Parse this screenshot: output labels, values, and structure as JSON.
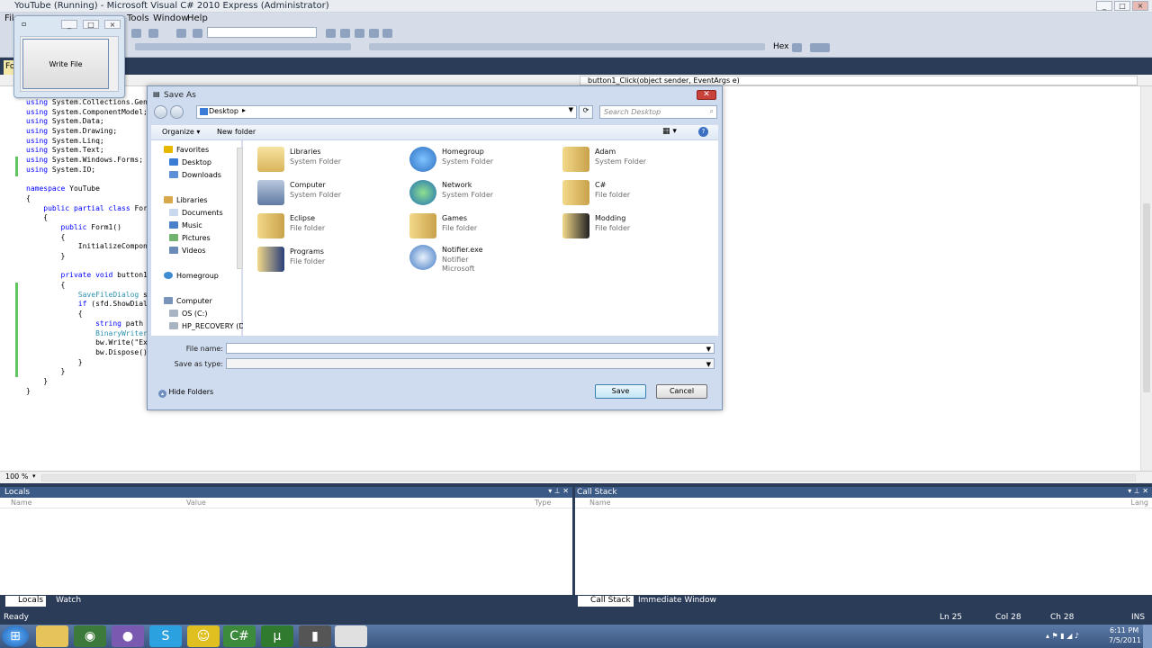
{
  "window": {
    "title": "YouTube (Running) - Microsoft Visual C# 2010 Express (Administrator)"
  },
  "menu": {
    "items": [
      "File",
      "Tools",
      "Window",
      "Help"
    ]
  },
  "doc_tab": "Fo",
  "nav_bar": {
    "method": "button1_Click(object sender, EventArgs e)"
  },
  "code_lines": [
    "using System.Collections.Gene",
    "using System.ComponentModel;",
    "using System.Data;",
    "using System.Drawing;",
    "using System.Linq;",
    "using System.Text;",
    "using System.Windows.Forms;",
    "using System.IO;",
    "",
    "namespace YouTube",
    "{",
    "    public partial class Form",
    "    {",
    "        public Form1()",
    "        {",
    "            InitializeCompone",
    "        }",
    "",
    "        private void button1_",
    "        {",
    "            SaveFileDialog s",
    "            if (sfd.ShowDial",
    "            {",
    "                string path =",
    "                BinaryWriter",
    "                bw.Write(\"Exa",
    "                bw.Dispose();",
    "            }",
    "        }",
    "    }",
    "}"
  ],
  "zoom": "100 %",
  "form1": {
    "button_label": "Write File"
  },
  "dialog": {
    "title": "Save As",
    "address": "Desktop",
    "search_placeholder": "Search Desktop",
    "organize": "Organize",
    "new_folder": "New folder",
    "nav": {
      "favorites": "Favorites",
      "desktop": "Desktop",
      "downloads": "Downloads",
      "libraries": "Libraries",
      "documents": "Documents",
      "music": "Music",
      "pictures": "Pictures",
      "videos": "Videos",
      "homegroup": "Homegroup",
      "computer": "Computer",
      "os_c": "OS (C:)",
      "hp_recovery": "HP_RECOVERY (D"
    },
    "items": [
      {
        "name": "Libraries",
        "type": "System Folder"
      },
      {
        "name": "Homegroup",
        "type": "System Folder"
      },
      {
        "name": "Adam",
        "type": "System Folder"
      },
      {
        "name": "Computer",
        "type": "System Folder"
      },
      {
        "name": "Network",
        "type": "System Folder"
      },
      {
        "name": "C#",
        "type": "File folder"
      },
      {
        "name": "Eclipse",
        "type": "File folder"
      },
      {
        "name": "Games",
        "type": "File folder"
      },
      {
        "name": "Modding",
        "type": "File folder"
      },
      {
        "name": "Programs",
        "type": "File folder"
      },
      {
        "name": "Notifier.exe",
        "type": "Notifier",
        "extra": "Microsoft"
      }
    ],
    "file_name_label": "File name:",
    "file_name_value": "",
    "save_as_type_label": "Save as type:",
    "save_as_type_value": "",
    "hide_folders": "Hide Folders",
    "save": "Save",
    "cancel": "Cancel"
  },
  "locals_pane": {
    "title": "Locals",
    "columns": [
      "Name",
      "Value",
      "Type"
    ]
  },
  "callstack_pane": {
    "title": "Call Stack",
    "columns": [
      "Name",
      "Lang"
    ]
  },
  "bottom_tabs_left": [
    "Locals",
    "Watch"
  ],
  "bottom_tabs_right": [
    "Call Stack",
    "Immediate Window"
  ],
  "status": {
    "left": "Ready",
    "ln": "Ln 25",
    "col": "Col 28",
    "ch": "Ch 28",
    "mode": "INS"
  },
  "clock": {
    "time": "6:11 PM",
    "date": "7/5/2011"
  }
}
